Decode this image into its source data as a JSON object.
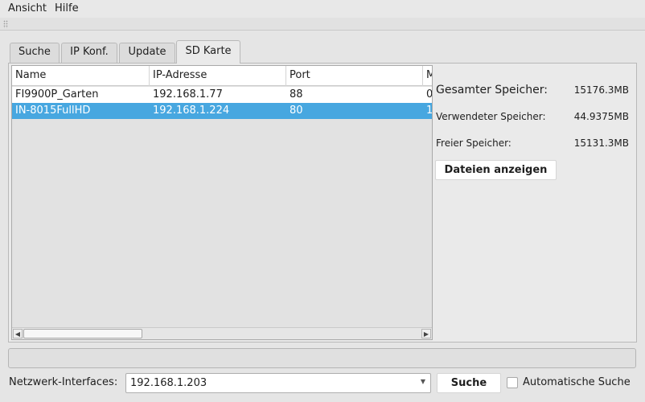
{
  "menu": [
    "Ansicht",
    "Hilfe"
  ],
  "tabs": [
    "Suche",
    "IP Konf.",
    "Update",
    "SD Karte"
  ],
  "active_tab": "SD Karte",
  "table": {
    "columns": [
      "Name",
      "IP-Adresse",
      "Port",
      "M"
    ],
    "rows": [
      {
        "name": "FI9900P_Garten",
        "ip": "192.168.1.77",
        "port": "88",
        "extra": "0",
        "selected": false
      },
      {
        "name": "IN-8015FullHD",
        "ip": "192.168.1.224",
        "port": "80",
        "extra": "1",
        "selected": true
      }
    ]
  },
  "storage": {
    "total_label": "Gesamter Speicher:",
    "total_value": "15176.3MB",
    "used_label": "Verwendeter Speicher:",
    "used_value": "44.9375MB",
    "free_label": "Freier Speicher:",
    "free_value": "15131.3MB",
    "show_files_button": "Dateien anzeigen"
  },
  "progress": 0,
  "footer": {
    "interfaces_label": "Netzwerk-Interfaces:",
    "interface_value": "192.168.1.203",
    "search_button": "Suche",
    "auto_search_label": "Automatische Suche",
    "auto_search_checked": false
  },
  "colors": {
    "selection": "#47a7e0",
    "background": "#e5e5e5"
  }
}
